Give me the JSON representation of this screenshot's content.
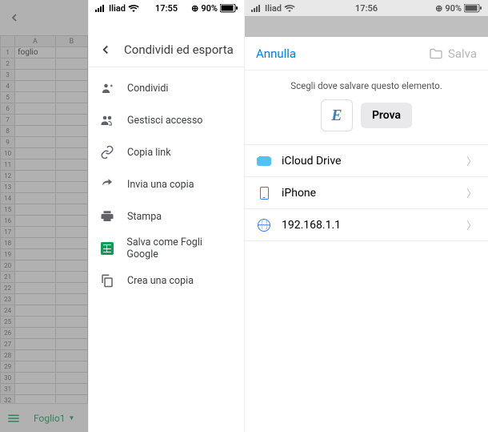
{
  "status": {
    "carrier_left": "Iliad",
    "carrier_right": "Iliad",
    "time_p2": "17:55",
    "time_p3": "17:56",
    "battery_pct": "90%"
  },
  "sheet": {
    "colA": "A",
    "colB": "B",
    "cell_a1": "foglio",
    "tab_name": "Foglio1"
  },
  "menu": {
    "title": "Condividi ed esporta",
    "items": [
      {
        "label": "Condividi"
      },
      {
        "label": "Gestisci accesso"
      },
      {
        "label": "Copia link"
      },
      {
        "label": "Invia una copia"
      },
      {
        "label": "Stampa"
      },
      {
        "label": "Salva come Fogli Google"
      },
      {
        "label": "Crea una copia"
      }
    ]
  },
  "save": {
    "cancel": "Annulla",
    "save": "Salva",
    "prompt": "Scegli dove salvare questo elemento.",
    "file_letter": "E",
    "file_name": "Prova",
    "locations": [
      {
        "label": "iCloud Drive"
      },
      {
        "label": "iPhone"
      },
      {
        "label": "192.168.1.1"
      }
    ]
  }
}
